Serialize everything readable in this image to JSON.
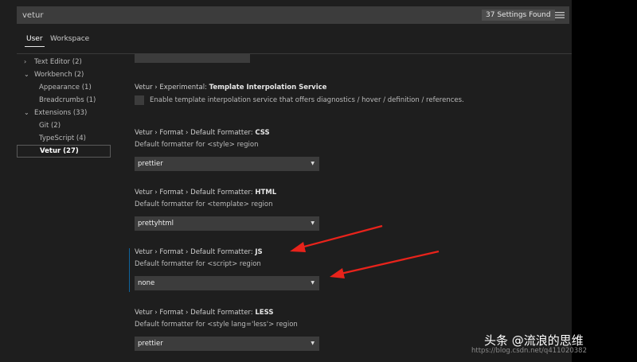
{
  "search": {
    "query": "vetur",
    "count_label": "37 Settings Found",
    "filter_icon": "filter-list-icon"
  },
  "scope_tabs": [
    {
      "label": "User",
      "active": true
    },
    {
      "label": "Workspace",
      "active": false
    }
  ],
  "toc": [
    {
      "label": "Text Editor (2)",
      "level": 0,
      "expanded": false
    },
    {
      "label": "Workbench (2)",
      "level": 0,
      "expanded": true
    },
    {
      "label": "Appearance (1)",
      "level": 1
    },
    {
      "label": "Breadcrumbs (1)",
      "level": 1
    },
    {
      "label": "Extensions (33)",
      "level": 0,
      "expanded": true
    },
    {
      "label": "Git (2)",
      "level": 1
    },
    {
      "label": "TypeScript (4)",
      "level": 1
    },
    {
      "label": "Vetur (27)",
      "level": 1,
      "selected": true
    }
  ],
  "settings": {
    "template_interpolation": {
      "category": "Vetur › Experimental: ",
      "name": "Template Interpolation Service",
      "description": "Enable template interpolation service that offers diagnostics / hover / definition / references.",
      "checked": false
    },
    "formatter_css": {
      "category": "Vetur › Format › Default Formatter: ",
      "name": "CSS",
      "description": "Default formatter for <style> region",
      "value": "prettier"
    },
    "formatter_html": {
      "category": "Vetur › Format › Default Formatter: ",
      "name": "HTML",
      "description": "Default formatter for <template> region",
      "value": "prettyhtml"
    },
    "formatter_js": {
      "category": "Vetur › Format › Default Formatter: ",
      "name": "JS",
      "description": "Default formatter for <script> region",
      "value": "none"
    },
    "formatter_less": {
      "category": "Vetur › Format › Default Formatter: ",
      "name": "LESS",
      "description": "Default formatter for <style lang='less'> region",
      "value": "prettier"
    }
  },
  "watermark": {
    "url": "https://blog.csdn.net/q411020382",
    "brand": "头条 @流浪的思维"
  },
  "colors": {
    "accent": "#0e639c",
    "annotation_arrow": "#e8231b",
    "editor_bg": "#1e1e1e",
    "input_bg": "#3c3c3c"
  }
}
